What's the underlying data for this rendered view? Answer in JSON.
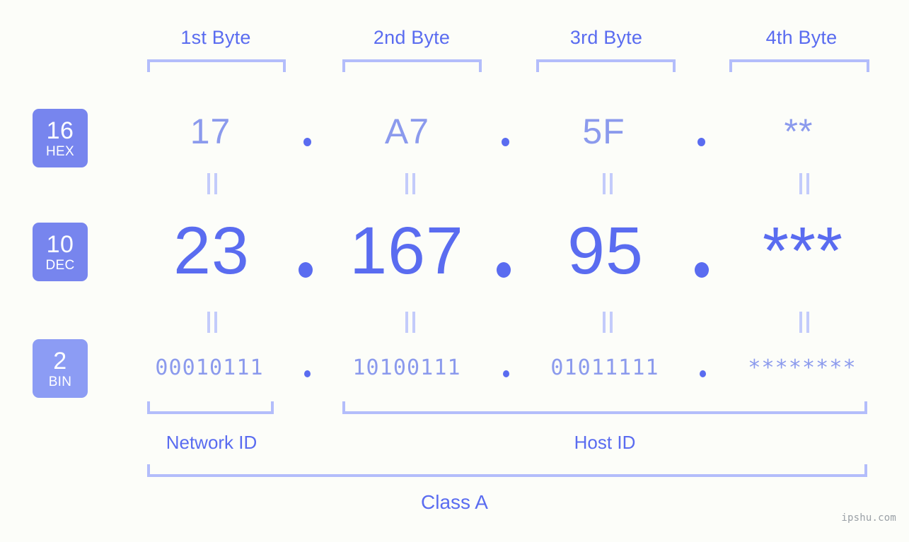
{
  "meta": {
    "background_color": "#fcfdf9",
    "accent_strong": "#5a6cf0",
    "accent_light": "#8b9aed",
    "accent_pale": "#b3bdfb",
    "badge_color": "#7785ee",
    "badge_color_bin": "#8c9cf4",
    "watermark": "ipshu.com"
  },
  "byte_headers": [
    {
      "label": "1st Byte"
    },
    {
      "label": "2nd Byte"
    },
    {
      "label": "3rd Byte"
    },
    {
      "label": "4th Byte"
    }
  ],
  "bases": [
    {
      "number": "16",
      "name": "HEX"
    },
    {
      "number": "10",
      "name": "DEC"
    },
    {
      "number": "2",
      "name": "BIN"
    }
  ],
  "rows": {
    "hex": {
      "base_number": "16",
      "base_name": "HEX",
      "values": [
        "17",
        "A7",
        "5F",
        "**"
      ],
      "separator": "."
    },
    "dec": {
      "base_number": "10",
      "base_name": "DEC",
      "values": [
        "23",
        "167",
        "95",
        "***"
      ],
      "separator": "."
    },
    "bin": {
      "base_number": "2",
      "base_name": "BIN",
      "values": [
        "00010111",
        "10100111",
        "01011111",
        "********"
      ],
      "separator": "."
    }
  },
  "equality_marks": {
    "glyph": "=",
    "description": "rotated equals sign linking rows"
  },
  "sections": {
    "network_id": "Network ID",
    "host_id": "Host ID",
    "class": "Class A"
  }
}
